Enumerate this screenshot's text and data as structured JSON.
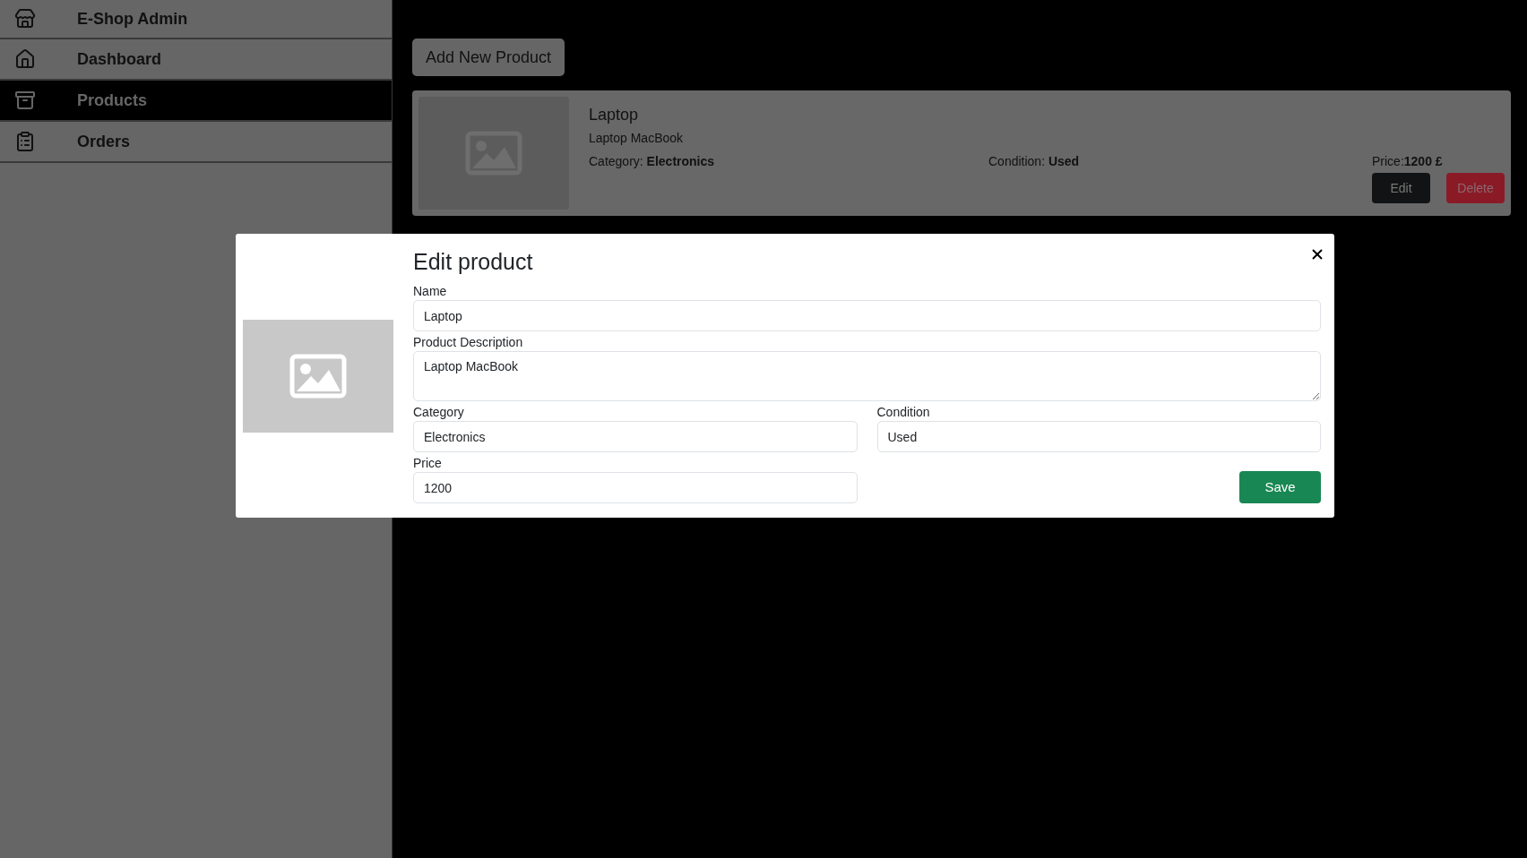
{
  "sidebar": {
    "title": "E-Shop Admin",
    "items": [
      {
        "label": "Dashboard",
        "selected": false
      },
      {
        "label": "Products",
        "selected": true
      },
      {
        "label": "Orders",
        "selected": false
      }
    ]
  },
  "add_button": "Add New Product",
  "products": [
    {
      "name": "Laptop",
      "description": "Laptop MacBook",
      "category": "Category: **Electronics**",
      "condition": "Condition: **Used**",
      "price": "Price:**1200 £**",
      "edit": "Edit",
      "delete": "Delete"
    }
  ],
  "modal": {
    "title": "Edit product",
    "fields": [
      {
        "kind": "input",
        "label": "Name",
        "value": "Laptop"
      },
      {
        "kind": "textarea",
        "label": "Product Description",
        "value": "Laptop MacBook"
      },
      {
        "kind": "input",
        "label": "Category",
        "value": "Electronics"
      },
      {
        "kind": "input",
        "label": "Condition",
        "value": "Used"
      },
      {
        "kind": "input",
        "label": "Price",
        "value": "1200"
      }
    ],
    "save": "Save"
  }
}
